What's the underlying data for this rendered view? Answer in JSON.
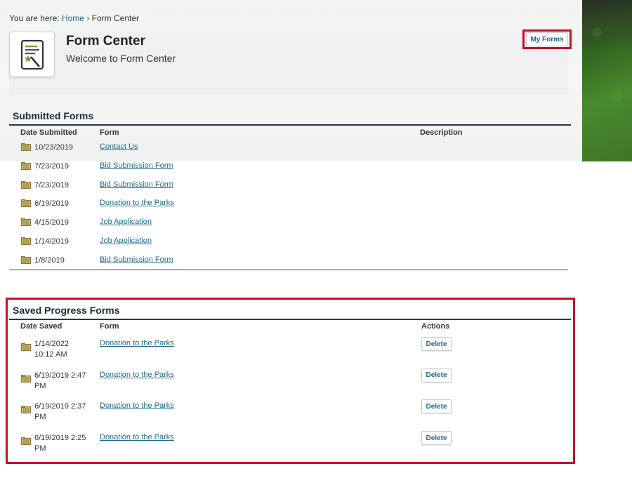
{
  "breadcrumb": {
    "prefix": "You are here:",
    "home": "Home",
    "separator": "›",
    "current": "Form Center"
  },
  "header": {
    "title": "Form Center",
    "subtitle": "Welcome to Form Center",
    "my_forms_label": "My Forms"
  },
  "submitted": {
    "title": "Submitted Forms",
    "columns": {
      "date": "Date Submitted",
      "form": "Form",
      "description": "Description"
    },
    "rows": [
      {
        "date": "10/23/2019",
        "form": "Contact Us"
      },
      {
        "date": "7/23/2019",
        "form": "Bid Submission Form"
      },
      {
        "date": "7/23/2019",
        "form": "Bid Submission Form"
      },
      {
        "date": "6/19/2019",
        "form": "Donation to the Parks"
      },
      {
        "date": "4/15/2019",
        "form": "Job Application"
      },
      {
        "date": "1/14/2019",
        "form": "Job Application"
      },
      {
        "date": "1/8/2019",
        "form": "Bid Submission Form"
      }
    ]
  },
  "saved": {
    "title": "Saved Progress Forms",
    "columns": {
      "date": "Date Saved",
      "form": "Form",
      "actions": "Actions"
    },
    "delete_label": "Delete",
    "rows": [
      {
        "date_line1": "1/14/2022",
        "date_line2": "10:12 AM",
        "form": "Donation to the Parks"
      },
      {
        "date_line1": "6/19/2019 2:47",
        "date_line2": "PM",
        "form": "Donation to the Parks"
      },
      {
        "date_line1": "6/19/2019 2:37",
        "date_line2": "PM",
        "form": "Donation to the Parks"
      },
      {
        "date_line1": "6/19/2019 2:25",
        "date_line2": "PM",
        "form": "Donation to the Parks"
      }
    ]
  },
  "icons": {
    "form_center": "form-wand-icon",
    "row": "folder-icon"
  },
  "colors": {
    "link": "#1f6a8a",
    "highlight": "#c0122c",
    "rule": "#2c3545"
  }
}
